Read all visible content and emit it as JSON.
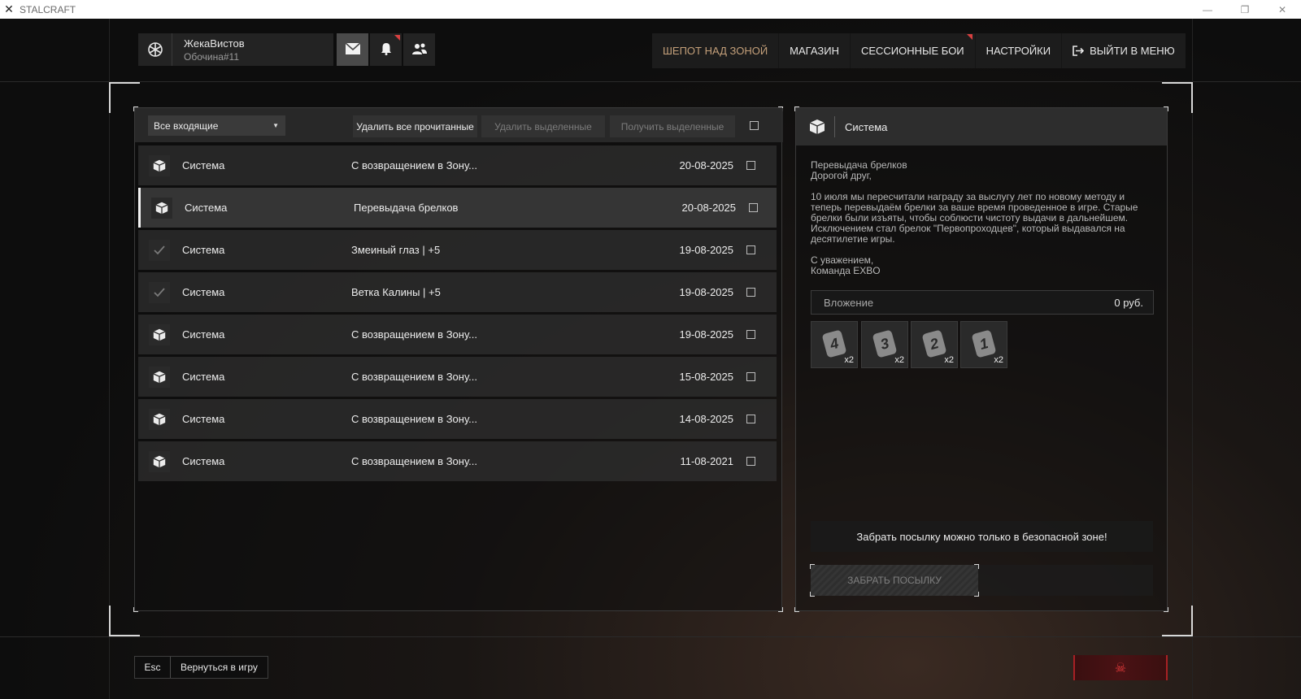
{
  "window": {
    "title": "STALCRAFT",
    "controls": [
      "—",
      "❐",
      "✕"
    ]
  },
  "user": {
    "name": "ЖекаВистов",
    "tag": "Обочина#11"
  },
  "header_buttons": [
    {
      "icon": "mail-icon",
      "active": true
    },
    {
      "icon": "bell-icon",
      "flag": true
    },
    {
      "icon": "friends-icon"
    }
  ],
  "nav": {
    "items": [
      {
        "label": "ШЕПОТ НАД ЗОНОЙ",
        "accent": true
      },
      {
        "label": "МАГАЗИН"
      },
      {
        "label": "СЕССИОННЫЕ БОИ",
        "flag": true
      },
      {
        "label": "НАСТРОЙКИ"
      },
      {
        "label": "ВЫЙТИ В МЕНЮ",
        "icon": "exit-icon"
      }
    ]
  },
  "inbox": {
    "filter": "Все входящие",
    "delete_read": "Удалить все прочитанные",
    "delete_selected": "Удалить выделенные",
    "receive_selected": "Получить выделенные",
    "messages": [
      {
        "icon": "box-icon",
        "sender": "Система",
        "subject": "С возвращением в Зону...",
        "date": "20-08-2025",
        "read": false
      },
      {
        "icon": "box-icon",
        "sender": "Система",
        "subject": "Перевыдача брелков",
        "date": "20-08-2025",
        "read": false,
        "selected": true
      },
      {
        "icon": "check-icon",
        "sender": "Система",
        "subject": "Змеиный глаз | +5",
        "date": "19-08-2025",
        "read": true
      },
      {
        "icon": "check-icon",
        "sender": "Система",
        "subject": "Ветка Калины | +5",
        "date": "19-08-2025",
        "read": true
      },
      {
        "icon": "box-icon",
        "sender": "Система",
        "subject": "С возвращением в Зону...",
        "date": "19-08-2025",
        "read": false
      },
      {
        "icon": "box-icon",
        "sender": "Система",
        "subject": "С возвращением в Зону...",
        "date": "15-08-2025",
        "read": false
      },
      {
        "icon": "box-icon",
        "sender": "Система",
        "subject": "С возвращением в Зону...",
        "date": "14-08-2025",
        "read": false
      },
      {
        "icon": "box-icon",
        "sender": "Система",
        "subject": "С возвращением в Зону...",
        "date": "11-08-2021",
        "read": false
      }
    ]
  },
  "message": {
    "sender": "Система",
    "body": [
      "Перевыдача брелков\nДорогой друг,",
      "10 июля мы пересчитали награду за выслугу лет по новому методу и\nтеперь перевыдаём брелки за ваше время проведенное в игре. Старые\nбрелки были изъяты, чтобы соблюсти чистоту выдачи в дальнейшем.\nИсключением стал брелок \"Первопроходцев\", который выдавался на\nдесятилетие игры.",
      "С уважением,\nКоманда EXBO"
    ],
    "attachment_label": "Вложение",
    "attachment_value": "0 руб.",
    "items": [
      {
        "digit": "4",
        "qty": "x2"
      },
      {
        "digit": "3",
        "qty": "x2"
      },
      {
        "digit": "2",
        "qty": "x2"
      },
      {
        "digit": "1",
        "qty": "x2"
      }
    ],
    "warning": "Забрать посылку можно только в безопасной зоне!",
    "take_button": "ЗАБРАТЬ ПОСЫЛКУ"
  },
  "footer": {
    "back_key": "Esc",
    "back_label": "Вернуться в игру",
    "quit_icon": "skull-icon"
  }
}
